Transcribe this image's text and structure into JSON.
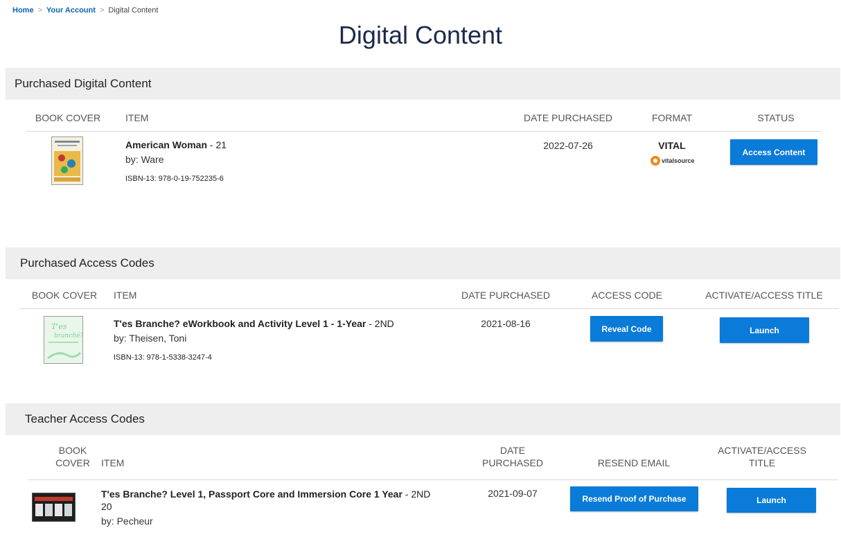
{
  "breadcrumb": {
    "home": "Home",
    "account": "Your Account",
    "current": "Digital Content",
    "sep": ">"
  },
  "page_title": "Digital Content",
  "purchased_digital": {
    "heading": "Purchased Digital Content",
    "columns": {
      "cover": "BOOK COVER",
      "item": "ITEM",
      "date": "DATE PURCHASED",
      "format": "FORMAT",
      "status": "STATUS"
    },
    "row": {
      "title": "American Woman",
      "edition": " - 21",
      "author": "by: Ware",
      "isbn": "ISBN-13: 978-0-19-752235-6",
      "date": "2022-07-26",
      "format": "VITAL",
      "format_logo": "vitalsource",
      "action": "Access Content"
    }
  },
  "purchased_codes": {
    "heading": "Purchased Access Codes",
    "columns": {
      "cover": "BOOK COVER",
      "item": "ITEM",
      "date": "DATE PURCHASED",
      "code": "ACCESS CODE",
      "activate": "ACTIVATE/ACCESS TITLE"
    },
    "row": {
      "title": "T'es Branche? eWorkbook and Activity Level 1 - 1-Year",
      "edition": " - 2ND",
      "author": "by: Theisen, Toni",
      "isbn": "ISBN-13: 978-1-5338-3247-4",
      "date": "2021-08-16",
      "code_action": "Reveal Code",
      "launch_action": "Launch"
    }
  },
  "teacher_codes": {
    "heading": "Teacher Access Codes",
    "columns": {
      "cover_1": "BOOK",
      "cover_2": "COVER",
      "item": "ITEM",
      "date_1": "DATE",
      "date_2": "PURCHASED",
      "resend": "RESEND EMAIL",
      "activate_1": "ACTIVATE/ACCESS",
      "activate_2": "TITLE"
    },
    "row": {
      "title": "T'es Branche? Level 1, Passport Core and Immersion Core 1 Year",
      "edition": " - 2ND",
      "edition_line2": "20",
      "author": "by: Pecheur",
      "date": "2021-09-07",
      "resend_action": "Resend Proof of Purchase",
      "launch_action": "Launch"
    }
  },
  "colors": {
    "accent": "#0a7bd8",
    "title": "#1c2a4a",
    "link": "#0b63b0",
    "bar": "#eeeeee"
  }
}
